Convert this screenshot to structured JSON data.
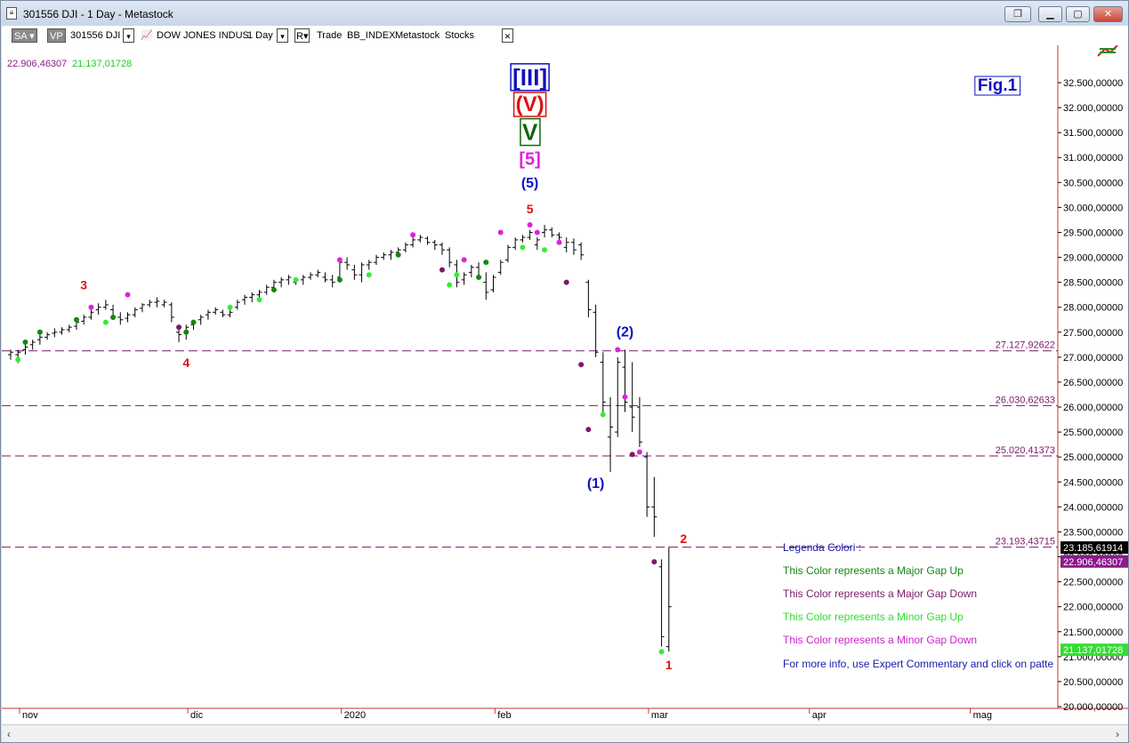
{
  "window": {
    "title": "301556 DJI - 1 Day - Metastock",
    "buttons": [
      "restore",
      "minimize",
      "maximize",
      "close"
    ]
  },
  "toolbar": {
    "sa": "SA",
    "vp": "VP",
    "symbol": "301556 DJI",
    "name": "DOW JONES INDUS",
    "period": "1 Day",
    "r": "R",
    "trade": "Trade",
    "index": "BB_INDEX",
    "source": "Metastock",
    "stocks": "Stocks"
  },
  "readout": {
    "high": "22.906,46307",
    "low": "21.137,01728"
  },
  "fig_label": "Fig.1",
  "y_axis": {
    "min": 20000,
    "max": 32500,
    "ticks": [
      "32.500,00000",
      "32.000,00000",
      "31.500,00000",
      "31.000,00000",
      "30.500,00000",
      "30.000,00000",
      "29.500,00000",
      "29.000,00000",
      "28.500,00000",
      "28.000,00000",
      "27.500,00000",
      "27.000,00000",
      "26.500,00000",
      "26.000,00000",
      "25.500,00000",
      "25.000,00000",
      "24.500,00000",
      "24.000,00000",
      "23.500,00000",
      "23.000,00000",
      "22.500,00000",
      "22.000,00000",
      "21.500,00000",
      "21.000,00000",
      "20.500,00000",
      "20.000,00000"
    ],
    "tick_values": [
      32500,
      32000,
      31500,
      31000,
      30500,
      30000,
      29500,
      29000,
      28500,
      28000,
      27500,
      27000,
      26500,
      26000,
      25500,
      25000,
      24500,
      24000,
      23500,
      23000,
      22500,
      22000,
      21500,
      21000,
      20500,
      20000
    ]
  },
  "x_axis": {
    "labels": [
      "nov",
      "dic",
      "2020",
      "feb",
      "mar",
      "apr",
      "mag"
    ],
    "label_days": [
      0,
      23,
      44,
      65,
      86,
      108,
      130
    ]
  },
  "price_markers": [
    {
      "text": "23.185,61914",
      "value": 23185.6,
      "bg": "#000000",
      "fg": "#ffffff"
    },
    {
      "text": "22.906,46307",
      "value": 22906.5,
      "bg": "#8b1a8b",
      "fg": "#ffffff"
    },
    {
      "text": "21.137,01728",
      "value": 21137.0,
      "bg": "#33dd33",
      "fg": "#ffffff"
    }
  ],
  "gap_lines": [
    {
      "label": "27.127,92622",
      "value": 27127.93
    },
    {
      "label": "26.030,62633",
      "value": 26030.63
    },
    {
      "label": "25.020,41373",
      "value": 25020.41
    },
    {
      "label": "23.193,43715",
      "value": 23193.44
    }
  ],
  "wave_labels": [
    {
      "text": "[III]",
      "color": "#1010c0",
      "boxed": true,
      "day": 71,
      "value": 32450,
      "size": 26
    },
    {
      "text": "(V)",
      "color": "#dd1111",
      "boxed": true,
      "day": 71,
      "value": 31930,
      "size": 24
    },
    {
      "text": "V",
      "color": "#116611",
      "boxed": true,
      "day": 71,
      "value": 31350,
      "size": 26
    },
    {
      "text": "[5]",
      "color": "#dd22dd",
      "boxed": false,
      "day": 71,
      "value": 30850,
      "size": 20
    },
    {
      "text": "(5)",
      "color": "#1010c0",
      "boxed": false,
      "day": 71,
      "value": 30400,
      "size": 16
    },
    {
      "text": "5",
      "color": "#dd1111",
      "boxed": false,
      "day": 71,
      "value": 29880,
      "size": 14
    },
    {
      "text": "3",
      "color": "#dd1111",
      "boxed": false,
      "day": 10,
      "value": 28360,
      "size": 14
    },
    {
      "text": "4",
      "color": "#dd1111",
      "boxed": false,
      "day": 24,
      "value": 26800,
      "size": 14
    },
    {
      "text": "(2)",
      "color": "#1010c0",
      "boxed": false,
      "day": 84,
      "value": 27420,
      "size": 16
    },
    {
      "text": "(1)",
      "color": "#1010c0",
      "boxed": false,
      "day": 80,
      "value": 24380,
      "size": 16
    },
    {
      "text": "2",
      "color": "#dd1111",
      "boxed": false,
      "day": 92,
      "value": 23280,
      "size": 14
    },
    {
      "text": "1",
      "color": "#dd1111",
      "boxed": false,
      "day": 90,
      "value": 20750,
      "size": 14
    }
  ],
  "legend": {
    "title": "Legenda Colori :",
    "items": [
      {
        "text": "This Color represents a Major Gap Up",
        "color": "#118811"
      },
      {
        "text": "This Color represents a Major Gap Down",
        "color": "#7a1a6a"
      },
      {
        "text": "This Color represents a Minor Gap Up",
        "color": "#33dd33"
      },
      {
        "text": "This Color represents a Minor Gap Down",
        "color": "#cc22cc"
      }
    ],
    "footer": "For more info, use Expert Commentary and click on patte"
  },
  "colors": {
    "major_gap_up": "#118811",
    "major_gap_down": "#7a1a6a",
    "minor_gap_up": "#33ee33",
    "minor_gap_down": "#dd22dd",
    "gap_line": "#7a1a6a",
    "bars": "#000000",
    "axis_border": "#cc3333"
  },
  "chart_data": {
    "type": "ohlc",
    "series_name": "301556 DJI",
    "bars": [
      [
        0,
        27050,
        27150,
        26950,
        27100
      ],
      [
        1,
        27050,
        27150,
        26880,
        27100
      ],
      [
        2,
        27150,
        27250,
        27050,
        27200
      ],
      [
        3,
        27250,
        27350,
        27150,
        27300
      ],
      [
        4,
        27350,
        27450,
        27250,
        27400
      ],
      [
        5,
        27400,
        27500,
        27350,
        27450
      ],
      [
        6,
        27480,
        27580,
        27400,
        27500
      ],
      [
        7,
        27500,
        27600,
        27450,
        27550
      ],
      [
        8,
        27550,
        27650,
        27500,
        27600
      ],
      [
        9,
        27620,
        27750,
        27550,
        27700
      ],
      [
        10,
        27720,
        27850,
        27650,
        27800
      ],
      [
        11,
        27800,
        27950,
        27750,
        27900
      ],
      [
        12,
        27950,
        28080,
        27850,
        28000
      ],
      [
        13,
        28000,
        28150,
        27950,
        28050
      ],
      [
        14,
        27950,
        28050,
        27750,
        27800
      ],
      [
        15,
        27800,
        27900,
        27650,
        27750
      ],
      [
        16,
        27780,
        27900,
        27700,
        27850
      ],
      [
        17,
        27850,
        28000,
        27800,
        27950
      ],
      [
        18,
        27980,
        28080,
        27900,
        28050
      ],
      [
        19,
        28050,
        28150,
        28000,
        28100
      ],
      [
        20,
        28100,
        28200,
        28000,
        28120
      ],
      [
        21,
        28050,
        28150,
        28000,
        28100
      ],
      [
        22,
        28050,
        28100,
        27700,
        27800
      ],
      [
        23,
        27500,
        27600,
        27300,
        27450
      ],
      [
        24,
        27500,
        27650,
        27350,
        27600
      ],
      [
        25,
        27650,
        27750,
        27550,
        27700
      ],
      [
        26,
        27750,
        27850,
        27650,
        27800
      ],
      [
        27,
        27850,
        27950,
        27750,
        27900
      ],
      [
        28,
        27900,
        28000,
        27850,
        27950
      ],
      [
        29,
        27900,
        27950,
        27800,
        27850
      ],
      [
        30,
        27850,
        27950,
        27800,
        27900
      ],
      [
        31,
        28000,
        28150,
        27950,
        28100
      ],
      [
        32,
        28150,
        28250,
        28050,
        28200
      ],
      [
        33,
        28200,
        28300,
        28100,
        28250
      ],
      [
        34,
        28250,
        28350,
        28150,
        28300
      ],
      [
        35,
        28300,
        28450,
        28250,
        28400
      ],
      [
        36,
        28400,
        28550,
        28350,
        28500
      ],
      [
        37,
        28500,
        28600,
        28400,
        28550
      ],
      [
        38,
        28550,
        28650,
        28450,
        28600
      ],
      [
        39,
        28500,
        28600,
        28450,
        28550
      ],
      [
        40,
        28550,
        28650,
        28450,
        28600
      ],
      [
        41,
        28600,
        28700,
        28550,
        28650
      ],
      [
        42,
        28650,
        28750,
        28600,
        28700
      ],
      [
        43,
        28600,
        28700,
        28500,
        28550
      ],
      [
        44,
        28550,
        28650,
        28400,
        28500
      ],
      [
        45,
        28600,
        28950,
        28550,
        28900
      ],
      [
        46,
        28900,
        29000,
        28750,
        28850
      ],
      [
        47,
        28750,
        28850,
        28550,
        28650
      ],
      [
        48,
        28650,
        28900,
        28500,
        28850
      ],
      [
        49,
        28850,
        28950,
        28750,
        28900
      ],
      [
        50,
        28900,
        29050,
        28850,
        29000
      ],
      [
        51,
        29000,
        29100,
        28950,
        29050
      ],
      [
        52,
        29050,
        29150,
        28950,
        29100
      ],
      [
        53,
        29100,
        29200,
        29000,
        29150
      ],
      [
        54,
        29150,
        29300,
        29100,
        29250
      ],
      [
        55,
        29250,
        29400,
        29200,
        29350
      ],
      [
        56,
        29350,
        29450,
        29300,
        29400
      ],
      [
        57,
        29380,
        29420,
        29250,
        29300
      ],
      [
        58,
        29300,
        29350,
        29150,
        29250
      ],
      [
        59,
        29250,
        29300,
        29050,
        29150
      ],
      [
        60,
        29150,
        29200,
        28800,
        28900
      ],
      [
        61,
        28850,
        28950,
        28400,
        28500
      ],
      [
        62,
        28550,
        28700,
        28450,
        28650
      ],
      [
        63,
        28700,
        28850,
        28600,
        28800
      ],
      [
        64,
        28800,
        28900,
        28550,
        28600
      ],
      [
        65,
        28500,
        28700,
        28150,
        28300
      ],
      [
        66,
        28350,
        28650,
        28300,
        28600
      ],
      [
        67,
        28700,
        28950,
        28650,
        28900
      ],
      [
        68,
        28950,
        29250,
        28900,
        29200
      ],
      [
        69,
        29200,
        29400,
        29150,
        29350
      ],
      [
        70,
        29350,
        29450,
        29300,
        29400
      ],
      [
        71,
        29400,
        29550,
        29350,
        29500
      ],
      [
        72,
        29250,
        29400,
        29150,
        29350
      ],
      [
        73,
        29500,
        29650,
        29400,
        29550
      ],
      [
        74,
        29550,
        29600,
        29400,
        29450
      ],
      [
        75,
        29450,
        29500,
        29300,
        29400
      ],
      [
        76,
        29200,
        29400,
        29100,
        29300
      ],
      [
        77,
        29300,
        29380,
        29050,
        29150
      ],
      [
        78,
        29250,
        29300,
        28950,
        29050
      ],
      [
        79,
        28500,
        28550,
        27800,
        27950
      ],
      [
        80,
        27900,
        28050,
        27000,
        27100
      ],
      [
        81,
        26900,
        27100,
        25800,
        26100
      ],
      [
        82,
        25400,
        26200,
        24700,
        25600
      ],
      [
        83,
        25500,
        27000,
        25400,
        26900
      ],
      [
        84,
        26800,
        27150,
        25900,
        26100
      ],
      [
        85,
        26000,
        26900,
        25500,
        25800
      ],
      [
        86,
        26000,
        26200,
        25200,
        25300
      ],
      [
        87,
        25000,
        25100,
        23800,
        24000
      ],
      [
        88,
        24000,
        24600,
        23400,
        23800
      ],
      [
        89,
        22800,
        22950,
        21200,
        21400
      ],
      [
        90,
        21200,
        23200,
        21100,
        22000
      ]
    ],
    "gap_dots": [
      {
        "day": 1,
        "value": 26950,
        "kind": "minor_gap_up"
      },
      {
        "day": 2,
        "value": 27300,
        "kind": "major_gap_up"
      },
      {
        "day": 4,
        "value": 27500,
        "kind": "major_gap_up"
      },
      {
        "day": 9,
        "value": 27750,
        "kind": "major_gap_up"
      },
      {
        "day": 11,
        "value": 28000,
        "kind": "minor_gap_down"
      },
      {
        "day": 13,
        "value": 27700,
        "kind": "minor_gap_up"
      },
      {
        "day": 14,
        "value": 27800,
        "kind": "major_gap_up"
      },
      {
        "day": 16,
        "value": 28250,
        "kind": "minor_gap_down"
      },
      {
        "day": 23,
        "value": 27600,
        "kind": "major_gap_down"
      },
      {
        "day": 24,
        "value": 27500,
        "kind": "major_gap_up"
      },
      {
        "day": 25,
        "value": 27700,
        "kind": "major_gap_up"
      },
      {
        "day": 30,
        "value": 28000,
        "kind": "minor_gap_up"
      },
      {
        "day": 34,
        "value": 28150,
        "kind": "minor_gap_up"
      },
      {
        "day": 36,
        "value": 28350,
        "kind": "major_gap_up"
      },
      {
        "day": 39,
        "value": 28550,
        "kind": "minor_gap_up"
      },
      {
        "day": 45,
        "value": 28550,
        "kind": "major_gap_up"
      },
      {
        "day": 45,
        "value": 28950,
        "kind": "minor_gap_down"
      },
      {
        "day": 49,
        "value": 28650,
        "kind": "minor_gap_up"
      },
      {
        "day": 53,
        "value": 29050,
        "kind": "major_gap_up"
      },
      {
        "day": 55,
        "value": 29450,
        "kind": "minor_gap_down"
      },
      {
        "day": 59,
        "value": 28750,
        "kind": "major_gap_down"
      },
      {
        "day": 60,
        "value": 28450,
        "kind": "minor_gap_up"
      },
      {
        "day": 61,
        "value": 28650,
        "kind": "minor_gap_up"
      },
      {
        "day": 62,
        "value": 28950,
        "kind": "minor_gap_down"
      },
      {
        "day": 64,
        "value": 28600,
        "kind": "major_gap_up"
      },
      {
        "day": 65,
        "value": 28900,
        "kind": "major_gap_up"
      },
      {
        "day": 67,
        "value": 29500,
        "kind": "minor_gap_down"
      },
      {
        "day": 70,
        "value": 29200,
        "kind": "minor_gap_up"
      },
      {
        "day": 71,
        "value": 29650,
        "kind": "minor_gap_down"
      },
      {
        "day": 72,
        "value": 29500,
        "kind": "minor_gap_down"
      },
      {
        "day": 73,
        "value": 29150,
        "kind": "minor_gap_up"
      },
      {
        "day": 75,
        "value": 29300,
        "kind": "minor_gap_down"
      },
      {
        "day": 76,
        "value": 28500,
        "kind": "major_gap_down"
      },
      {
        "day": 78,
        "value": 26850,
        "kind": "major_gap_down"
      },
      {
        "day": 79,
        "value": 25550,
        "kind": "major_gap_down"
      },
      {
        "day": 81,
        "value": 25850,
        "kind": "minor_gap_up"
      },
      {
        "day": 83,
        "value": 27150,
        "kind": "minor_gap_down"
      },
      {
        "day": 84,
        "value": 26200,
        "kind": "minor_gap_down"
      },
      {
        "day": 85,
        "value": 25050,
        "kind": "major_gap_down"
      },
      {
        "day": 86,
        "value": 25100,
        "kind": "minor_gap_down"
      },
      {
        "day": 88,
        "value": 22900,
        "kind": "major_gap_down"
      },
      {
        "day": 89,
        "value": 21100,
        "kind": "minor_gap_up"
      }
    ]
  }
}
